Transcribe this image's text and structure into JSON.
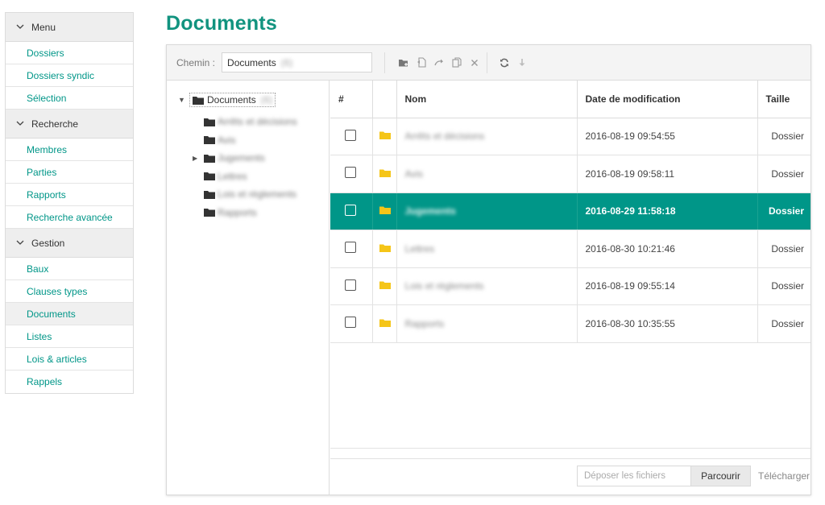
{
  "sidebar": {
    "sections": [
      {
        "title": "Menu",
        "items": [
          "Dossiers",
          "Dossiers syndic",
          "Sélection"
        ]
      },
      {
        "title": "Recherche",
        "items": [
          "Membres",
          "Parties",
          "Rapports",
          "Recherche avancée"
        ]
      },
      {
        "title": "Gestion",
        "items": [
          "Baux",
          "Clauses types",
          "Documents",
          "Listes",
          "Lois & articles",
          "Rappels"
        ]
      }
    ],
    "active_item": "Documents"
  },
  "page": {
    "title": "Documents"
  },
  "toolbar": {
    "path_label": "Chemin :",
    "path_value": "Documents",
    "path_count": "(6)",
    "icons": [
      "new-folder-icon",
      "rename-icon",
      "move-icon",
      "copy-icon",
      "delete-icon",
      "refresh-icon",
      "download-icon"
    ]
  },
  "tree": {
    "root_label": "Documents",
    "root_count": "(6)",
    "children": [
      "Arrêts et décisions",
      "Avis",
      "Jugements",
      "Lettres",
      "Lois et règlements",
      "Rapports"
    ]
  },
  "table": {
    "headers": [
      "#",
      "",
      "Nom",
      "Date de modification",
      "Taille"
    ],
    "rows": [
      {
        "name": "Arrêts et décisions",
        "date": "2016-08-19 09:54:55",
        "size": "Dossier",
        "selected": false
      },
      {
        "name": "Avis",
        "date": "2016-08-19 09:58:11",
        "size": "Dossier",
        "selected": false
      },
      {
        "name": "Jugements",
        "date": "2016-08-29 11:58:18",
        "size": "Dossier",
        "selected": true
      },
      {
        "name": "Lettres",
        "date": "2016-08-30 10:21:46",
        "size": "Dossier",
        "selected": false
      },
      {
        "name": "Lois et règlements",
        "date": "2016-08-19 09:55:14",
        "size": "Dossier",
        "selected": false
      },
      {
        "name": "Rapports",
        "date": "2016-08-30 10:35:55",
        "size": "Dossier",
        "selected": false
      }
    ]
  },
  "upload": {
    "placeholder": "Déposer les fichiers",
    "browse_label": "Parcourir",
    "submit_label": "Télécharger"
  },
  "colors": {
    "accent": "#009688",
    "title": "#11937f",
    "folder": "#f5c518"
  }
}
